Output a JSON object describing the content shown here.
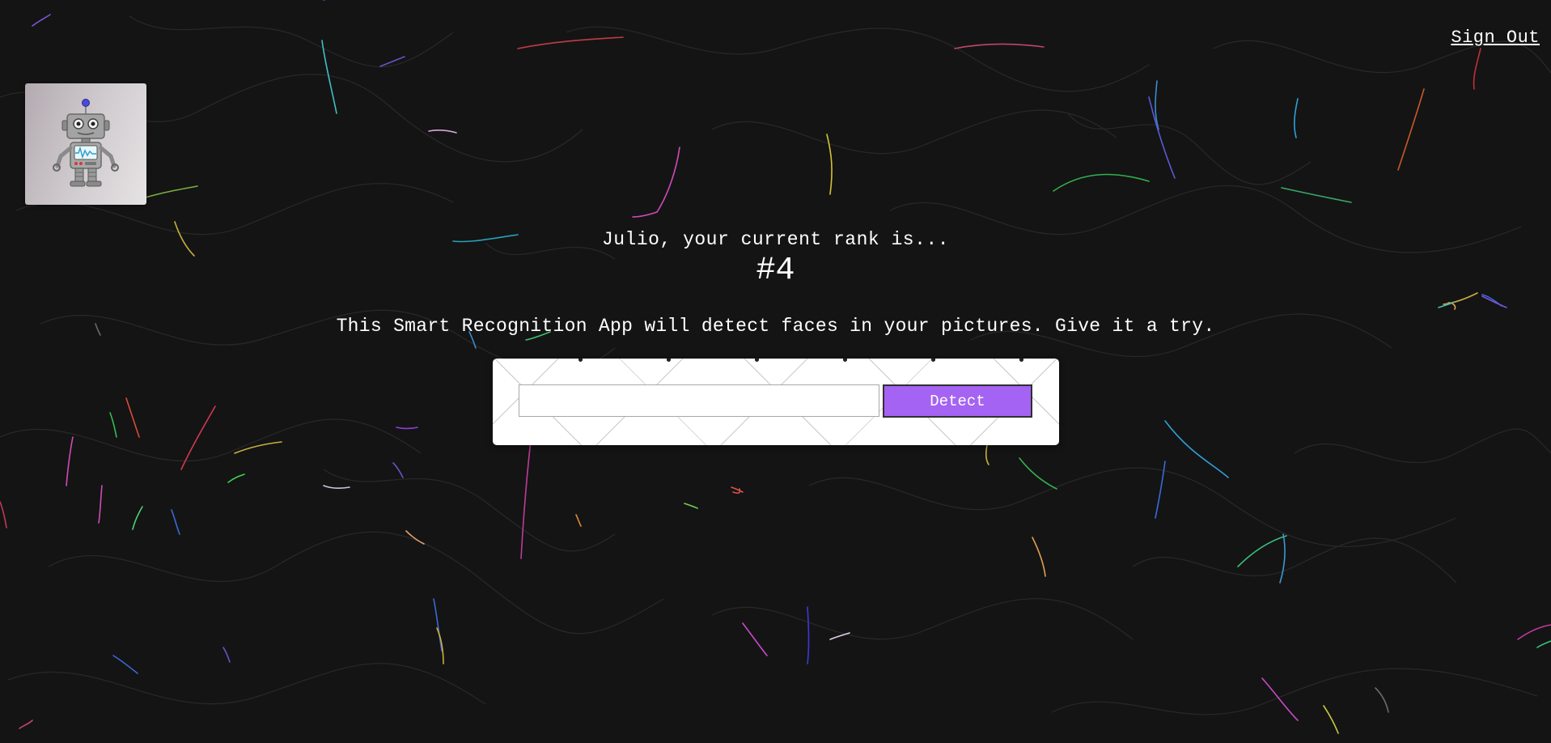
{
  "header": {
    "sign_out_label": "Sign Out"
  },
  "logo": {
    "icon": "robot-icon"
  },
  "rank": {
    "message": "Julio, your current rank is...",
    "value": "#4"
  },
  "intro": {
    "text": "This Smart Recognition App will detect faces in your pictures. Give it a try."
  },
  "form": {
    "input_value": "",
    "input_placeholder": "",
    "detect_label": "Detect"
  },
  "colors": {
    "background": "#141414",
    "accent_button": "#a463f2",
    "text": "#ffffff"
  }
}
